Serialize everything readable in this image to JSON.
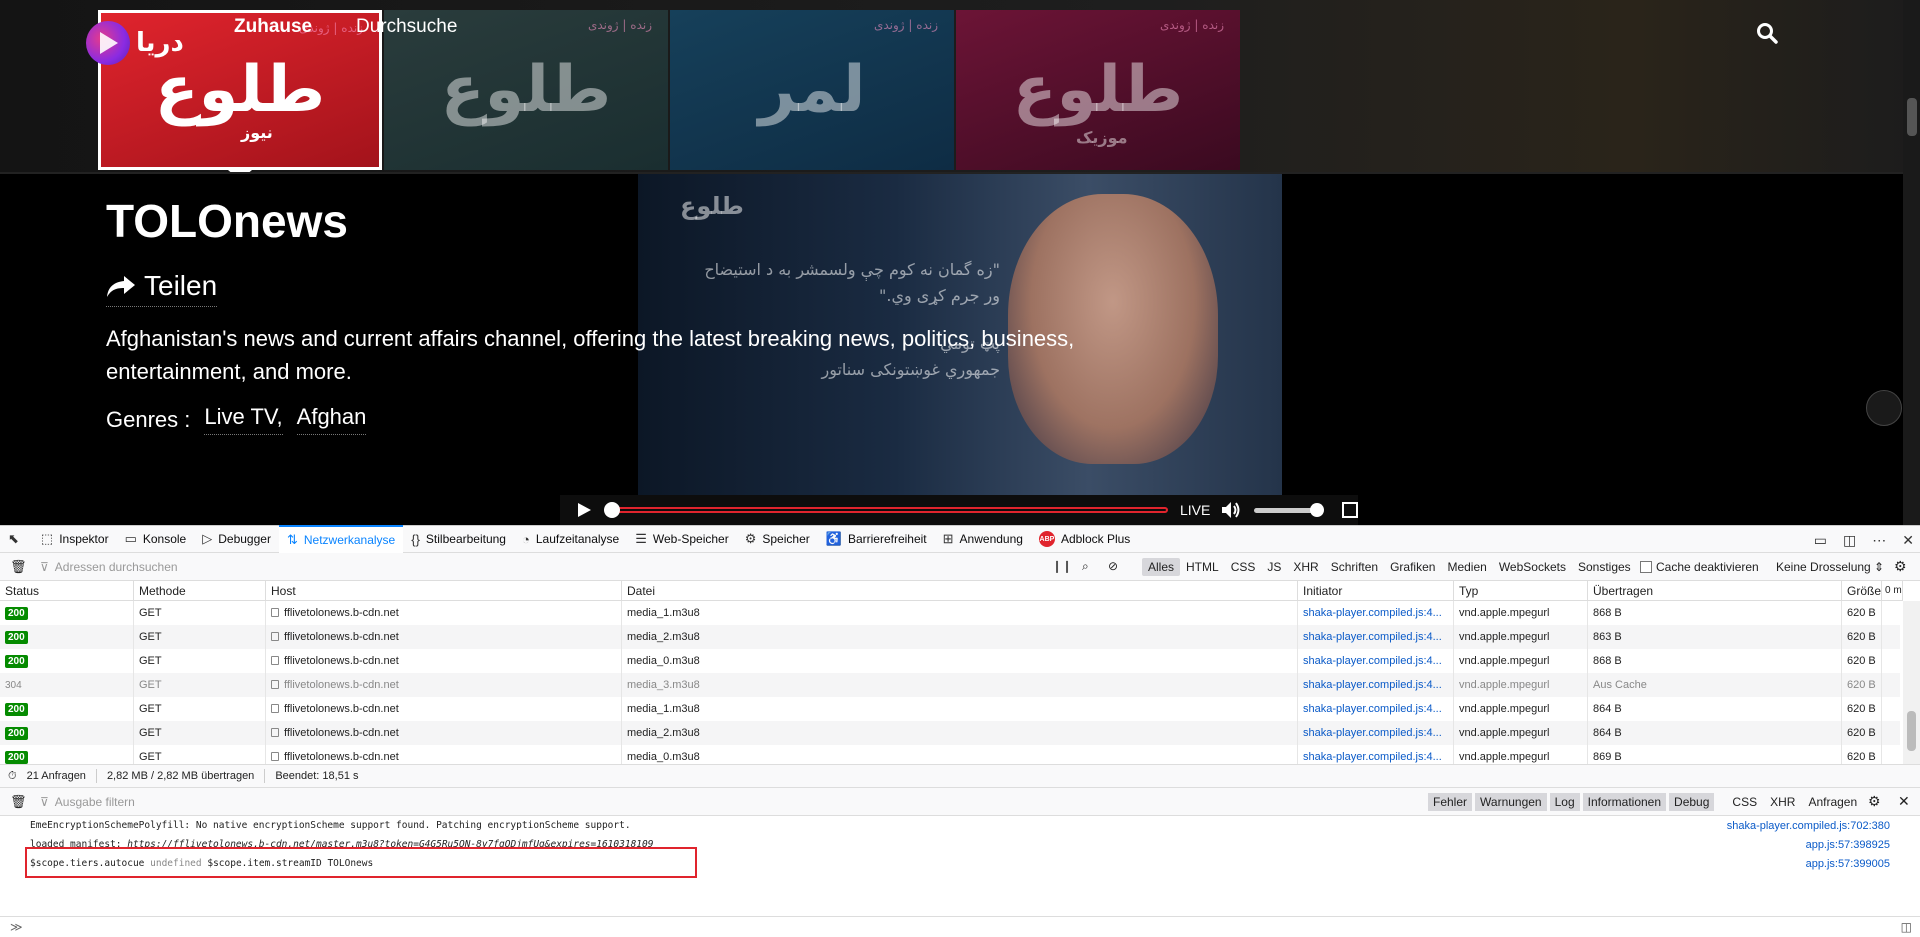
{
  "site": {
    "logo_text": "دریا",
    "nav": [
      {
        "label": "Zuhause"
      },
      {
        "label": "Durchsuche"
      }
    ],
    "channels": [
      {
        "logo": "طلوع",
        "sub": "نیوز",
        "live": "زنده | ژوندی"
      },
      {
        "logo": "طلوع",
        "sub": "",
        "live": "زنده | ژوندی"
      },
      {
        "logo": "لمر",
        "sub": "",
        "live": "زنده | ژوندی"
      },
      {
        "logo": "طلوع",
        "sub": "موزیک",
        "live": "زنده | ژوندی"
      }
    ],
    "hero": {
      "title": "TOLOnews",
      "share_label": "Teilen",
      "description": "Afghanistan's news and current affairs channel, offering the latest breaking news, politics, business, entertainment, and more.",
      "genres_label": "Genres :",
      "genres": [
        "Live TV,",
        "Afghan"
      ],
      "image_quote_1": "\"زه گمان نه کوم چې ولسمشر به د استیضاح",
      "image_quote_2": "ور جرم کړی وي.\"",
      "image_name_1": "پټ تومي",
      "image_name_2": "جمهوري غوښتونکی سناتور",
      "image_logo": "طلوع"
    },
    "player": {
      "live_label": "LIVE",
      "progress": 0.0,
      "volume": 1.0
    }
  },
  "devtools": {
    "tabs": [
      {
        "icon": "⬚",
        "label": "Inspektor"
      },
      {
        "icon": "▭",
        "label": "Konsole"
      },
      {
        "icon": "▷",
        "label": "Debugger"
      },
      {
        "icon": "⇅",
        "label": "Netzwerkanalyse"
      },
      {
        "icon": "{}",
        "label": "Stilbearbeitung"
      },
      {
        "icon": "◔",
        "label": "Laufzeitanalyse"
      },
      {
        "icon": "☰",
        "label": "Web-Speicher"
      },
      {
        "icon": "⚙",
        "label": "Speicher"
      },
      {
        "icon": "♿",
        "label": "Barrierefreiheit"
      },
      {
        "icon": "⊞",
        "label": "Anwendung"
      },
      {
        "icon": "ABP",
        "label": "Adblock Plus"
      }
    ],
    "active_tab": "Netzwerkanalyse",
    "network": {
      "filter_placeholder": "Adressen durchsuchen",
      "type_filters": [
        "Alles",
        "HTML",
        "CSS",
        "JS",
        "XHR",
        "Schriften",
        "Grafiken",
        "Medien",
        "WebSockets",
        "Sonstiges"
      ],
      "cache_label": "Cache deaktivieren",
      "throttle_label": "Keine Drosselung ⇕",
      "columns": [
        "Status",
        "Methode",
        "Host",
        "Datei",
        "Initiator",
        "Typ",
        "Übertragen",
        "Größe",
        "0 m"
      ],
      "rows": [
        {
          "status": "200",
          "method": "GET",
          "host": "fflivetolonews.b-cdn.net",
          "file": "media_1.m3u8",
          "initiator": "shaka-player.compiled.js:4...",
          "type": "vnd.apple.mpegurl",
          "transferred": "868 B",
          "size": "620 B"
        },
        {
          "status": "200",
          "method": "GET",
          "host": "fflivetolonews.b-cdn.net",
          "file": "media_2.m3u8",
          "initiator": "shaka-player.compiled.js:4...",
          "type": "vnd.apple.mpegurl",
          "transferred": "863 B",
          "size": "620 B"
        },
        {
          "status": "200",
          "method": "GET",
          "host": "fflivetolonews.b-cdn.net",
          "file": "media_0.m3u8",
          "initiator": "shaka-player.compiled.js:4...",
          "type": "vnd.apple.mpegurl",
          "transferred": "868 B",
          "size": "620 B"
        },
        {
          "status": "304",
          "method": "GET",
          "host": "fflivetolonews.b-cdn.net",
          "file": "media_3.m3u8",
          "initiator": "shaka-player.compiled.js:4...",
          "type": "vnd.apple.mpegurl",
          "transferred": "Aus Cache",
          "size": "620 B"
        },
        {
          "status": "200",
          "method": "GET",
          "host": "fflivetolonews.b-cdn.net",
          "file": "media_1.m3u8",
          "initiator": "shaka-player.compiled.js:4...",
          "type": "vnd.apple.mpegurl",
          "transferred": "864 B",
          "size": "620 B"
        },
        {
          "status": "200",
          "method": "GET",
          "host": "fflivetolonews.b-cdn.net",
          "file": "media_2.m3u8",
          "initiator": "shaka-player.compiled.js:4...",
          "type": "vnd.apple.mpegurl",
          "transferred": "864 B",
          "size": "620 B"
        },
        {
          "status": "200",
          "method": "GET",
          "host": "fflivetolonews.b-cdn.net",
          "file": "media_0.m3u8",
          "initiator": "shaka-player.compiled.js:4...",
          "type": "vnd.apple.mpegurl",
          "transferred": "869 B",
          "size": "620 B"
        }
      ],
      "summary": {
        "requests": "21 Anfragen",
        "transferred": "2,82 MB / 2,82 MB übertragen",
        "finished": "Beendet: 18,51 s"
      }
    },
    "console": {
      "filter_placeholder": "Ausgabe filtern",
      "level_filters": [
        "Fehler",
        "Warnungen",
        "Log",
        "Informationen",
        "Debug"
      ],
      "extra_filters": [
        "CSS",
        "XHR",
        "Anfragen"
      ],
      "lines": [
        {
          "text": "EmeEncryptionSchemePolyfill: No native encryptionScheme support found. Patching encryptionScheme support.",
          "src": "shaka-player.compiled.js:702:380"
        },
        {
          "prefix": "loaded manifest:",
          "url": "https://fflivetolonews.b-cdn.net/master.m3u8?token=G4G5Ru5ON-8y7fgODjmfUg&expires=1610318109",
          "src": "app.js:57:398925"
        },
        {
          "prefix": "$scope.tiers.autocue",
          "undef": "undefined",
          "suffix": "$scope.item.streamID TOLOnews",
          "src": "app.js:57:399005"
        }
      ],
      "prompt": "≫"
    }
  }
}
